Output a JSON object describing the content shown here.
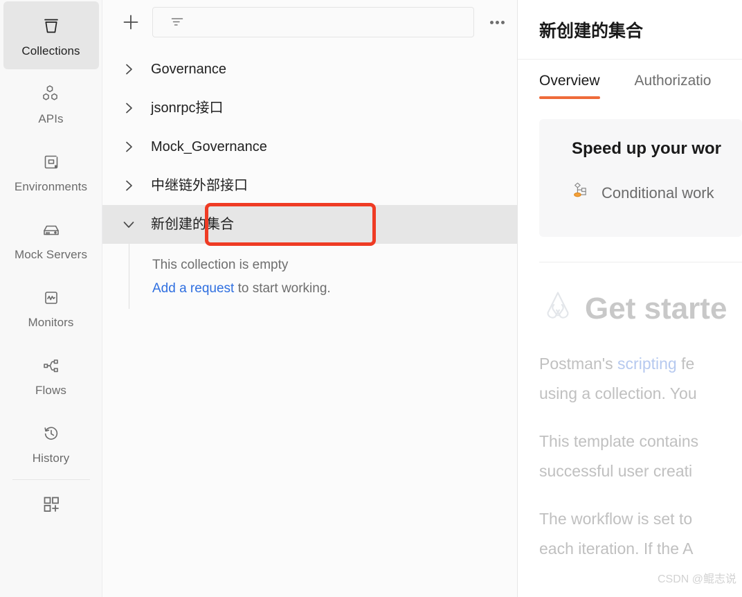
{
  "sidebar": {
    "items": [
      {
        "label": "Collections",
        "icon": "collections-icon",
        "active": true
      },
      {
        "label": "APIs",
        "icon": "apis-icon",
        "active": false
      },
      {
        "label": "Environments",
        "icon": "environments-icon",
        "active": false
      },
      {
        "label": "Mock Servers",
        "icon": "mock-servers-icon",
        "active": false
      },
      {
        "label": "Monitors",
        "icon": "monitors-icon",
        "active": false
      },
      {
        "label": "Flows",
        "icon": "flows-icon",
        "active": false
      },
      {
        "label": "History",
        "icon": "history-icon",
        "active": false
      }
    ],
    "footer_icon": "add-module-icon"
  },
  "toolbar": {
    "new_label": "+",
    "filter_placeholder": "",
    "filter_value": "",
    "filter_icon": "filter-icon",
    "more_icon": "more-horizontal-icon"
  },
  "collections": {
    "items": [
      {
        "label": "Governance",
        "expanded": false,
        "selected": false
      },
      {
        "label": "jsonrpc接口",
        "expanded": false,
        "selected": false
      },
      {
        "label": "Mock_Governance",
        "expanded": false,
        "selected": false
      },
      {
        "label": "中继链外部接口",
        "expanded": false,
        "selected": false
      },
      {
        "label": "新创建的集合",
        "expanded": true,
        "selected": true
      }
    ],
    "empty_state": {
      "line1": "This collection is empty",
      "link": "Add a request",
      "line2_rest": " to start working."
    }
  },
  "detail": {
    "title": "新创建的集合",
    "tabs": [
      {
        "label": "Overview",
        "active": true
      },
      {
        "label": "Authorizatio",
        "active": false
      }
    ],
    "promo": {
      "title": "Speed up your wor",
      "item_icon": "workflow-icon",
      "item_label": "Conditional work"
    },
    "doc": {
      "logo_icon": "postman-logo-icon",
      "heading": "Get starte",
      "paragraph1_a": "Postman's ",
      "paragraph1_link": "scripting",
      "paragraph1_b": " fe",
      "paragraph1_line2": "using a collection. You",
      "paragraph2_line1": "This template contains",
      "paragraph2_line2": "successful user creati",
      "paragraph3_line1": "The workflow is set to",
      "paragraph3_line2": "each iteration. If the A"
    }
  },
  "watermark": "CSDN @鲲志说",
  "colors": {
    "accent_orange": "#ef6b3a",
    "annotation_red": "#ef3b24",
    "link_blue": "#2f6fe0",
    "selected_row": "#e6e6e6"
  }
}
